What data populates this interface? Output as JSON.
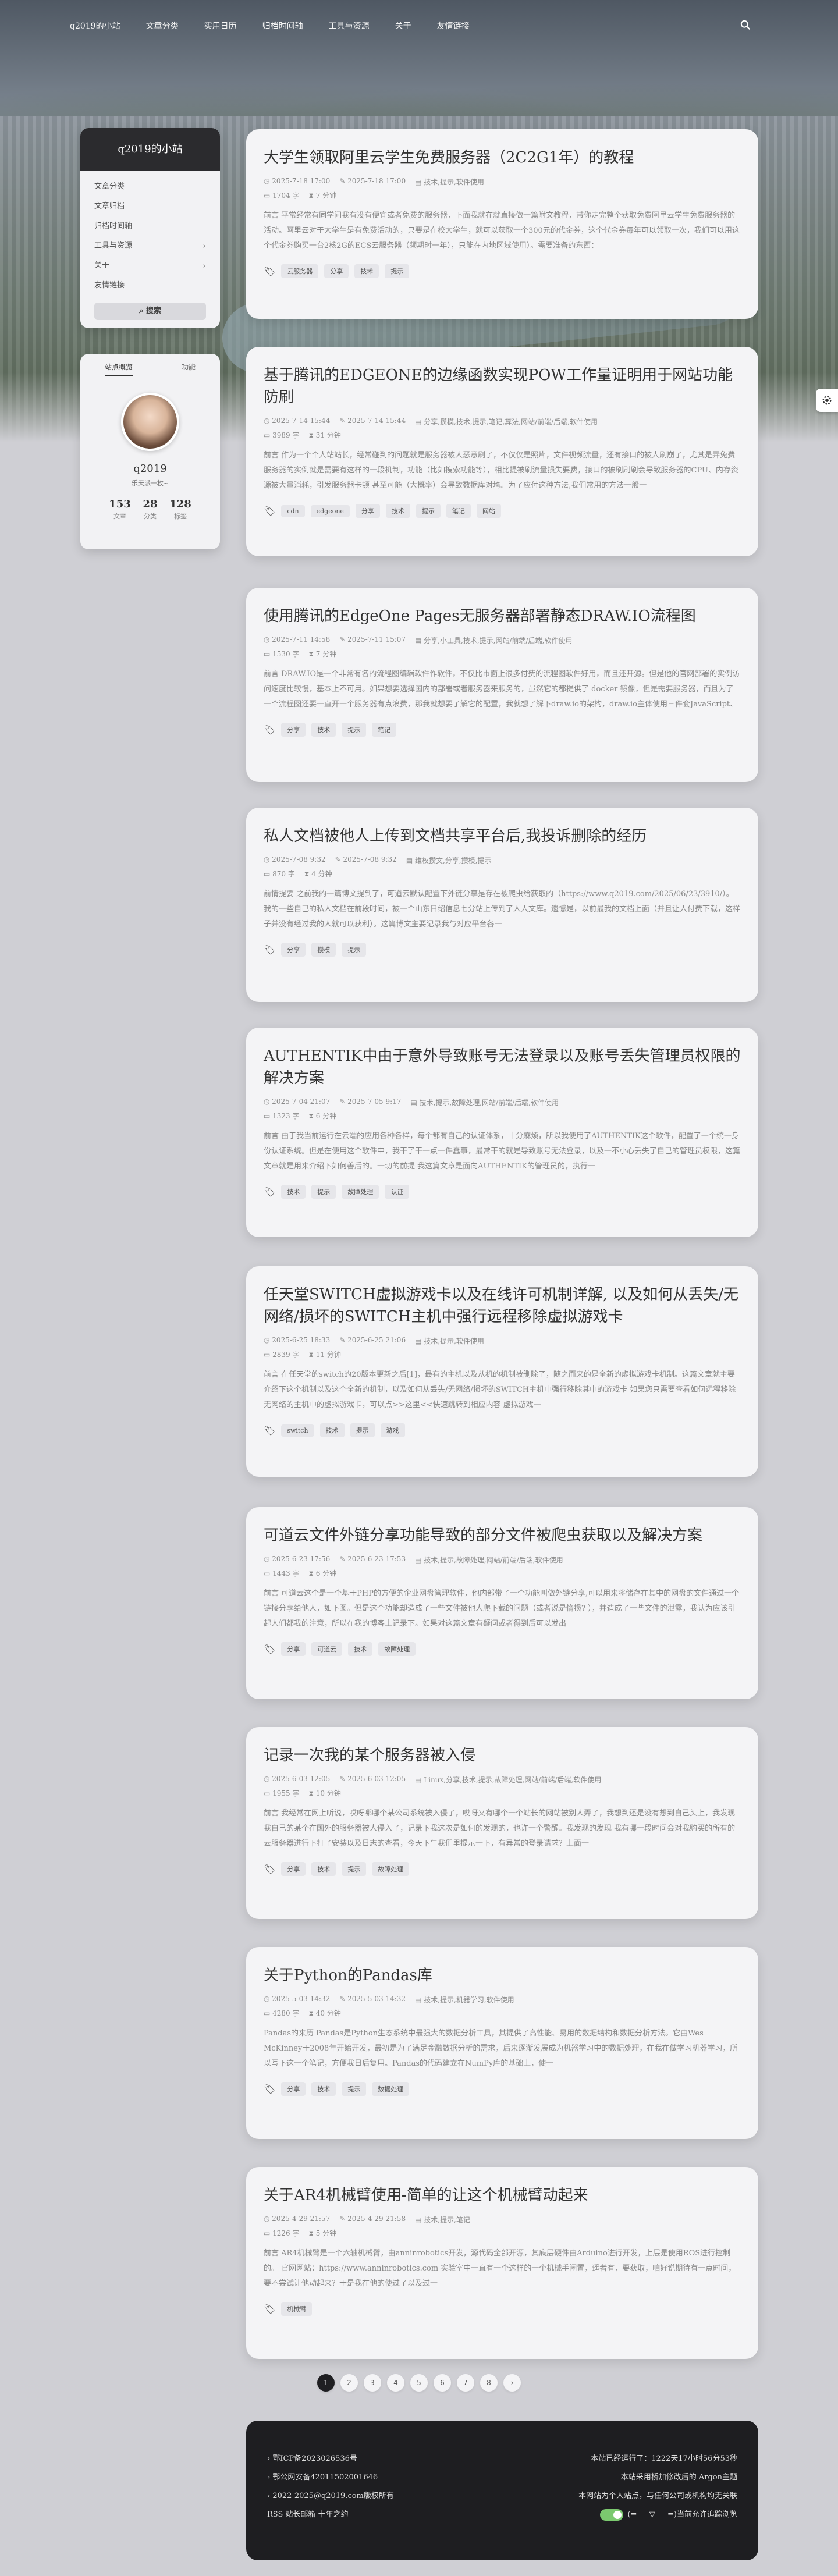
{
  "nav": {
    "site": "q2019的小站",
    "items": [
      "文章分类",
      "实用日历",
      "归档时间轴",
      "工具与资源",
      "关于",
      "友情链接"
    ]
  },
  "sidebar": {
    "title": "q2019的小站",
    "menu": [
      {
        "label": "文章分类",
        "chev": ""
      },
      {
        "label": "文章归档",
        "chev": ""
      },
      {
        "label": "归档时间轴",
        "chev": ""
      },
      {
        "label": "工具与资源",
        "chev": "›"
      },
      {
        "label": "关于",
        "chev": "›"
      },
      {
        "label": "友情链接",
        "chev": ""
      }
    ],
    "search_label": "搜索"
  },
  "profile": {
    "tab_overview": "站点概览",
    "tab_features": "功能",
    "name": "q2019",
    "motto": "乐天派一枚~",
    "stats": [
      {
        "n": "153",
        "l": "文章"
      },
      {
        "n": "28",
        "l": "分类"
      },
      {
        "n": "128",
        "l": "标签"
      }
    ]
  },
  "posts": [
    {
      "title": "大学生领取阿里云学生免费服务器（2C2G1年）的教程",
      "created": "2025-7-18 17:00",
      "updated": "2025-7-18 17:00",
      "cats": "技术,提示,软件使用",
      "words": "1704 字",
      "read": "7 分钟",
      "excerpt": "前言 平常经常有同学问我有没有便宜或者免费的服务器，下面我就在就直接做一篇附文教程，带你走完整个获取免费阿里云学生免费服务器的活动。阿里云对于大学生是有免费活动的，只要是在校大学生，就可以获取一个300元的代金券，这个代金券每年可以领取一次，我们可以用这个代金券购买一台2核2G的ECS云服务器（频期时一年），只能在内地区域使用）。需要准备的东西：",
      "tags": [
        "云服务器",
        "分享",
        "技术",
        "提示"
      ]
    },
    {
      "title": "基于腾讯的EDGEONE的边缘函数实现POW工作量证明用于网站功能防刷",
      "created": "2025-7-14 15:44",
      "updated": "2025-7-14 15:44",
      "cats": "分享,攒模,技术,提示,笔记,算法,网站/前端/后端,软件使用",
      "words": "3989 字",
      "read": "31 分钟",
      "excerpt": "前言 作为一个个人站站长，经常碰到的问题就是服务器被人恶意刷了，不仅仅是照片，文件视频流量，还有接口的被人刷崩了，尤其是弄免费服务器的实例就是需要有这样的一段机制，功能（比如搜索功能等），相比提被刷流量损失要费，接口的被刷刷刷会导致服务器的CPU、内存资源被大量消耗，引发服务器卡顿 甚至可能（大概率）会导致数据库对垮。为了应付这种方法,我们常用的方法一般一",
      "tags": [
        "cdn",
        "edgeone",
        "分享",
        "技术",
        "提示",
        "笔记",
        "网站"
      ]
    },
    {
      "title": "使用腾讯的EdgeOne Pages无服务器部署静态DRAW.IO流程图",
      "created": "2025-7-11 14:58",
      "updated": "2025-7-11 15:07",
      "cats": "分享,小工具,技术,提示,网站/前端/后端,软件使用",
      "words": "1530 字",
      "read": "7 分钟",
      "excerpt": "前言 DRAW.IO是一个非常有名的流程图编辑软件作软件，不仅比市面上很多付费的流程图软件好用，而且还开源。但是他的官网部署的实例访问速度比较慢，基本上不可用。如果想要选择国内的部署或者服务器来服务的，虽然它的都提供了 docker 镜像，但是需要服务器，而且为了一个流程图还要一直开一个服务器有点浪费，那我就想要了解它的配置，我就想了解下draw.io的架构，draw.io主体使用三件套JavaScript、Html一",
      "tags": [
        "分享",
        "技术",
        "提示",
        "笔记"
      ]
    },
    {
      "title": "私人文档被他人上传到文档共享平台后,我投诉删除的经历",
      "created": "2025-7-08 9:32",
      "updated": "2025-7-08 9:32",
      "cats": "维权攒文,分享,攒模,提示",
      "words": "870 字",
      "read": "4 分钟",
      "excerpt": "前情提要 之前我的一篇博文提到了，可道云默认配置下外链分享是存在被爬虫给获取的（https://www.q2019.com/2025/06/23/3910/）。我的一些自己的私人文档在前段时间，被一个山东日绍信息七分站上传到了人人文库。遗憾是，以前最我的文档上面（并且让人付费下载，这样子并没有经过我的人就可以获利）。这篇博文主要记录我与对应平台各一",
      "tags": [
        "分享",
        "攒模",
        "提示"
      ]
    },
    {
      "title": "AUTHENTIK中由于意外导致账号无法登录以及账号丢失管理员权限的解决方案",
      "created": "2025-7-04 21:07",
      "updated": "2025-7-05 9:17",
      "cats": "技术,提示,故障处理,网站/前端/后端,软件使用",
      "words": "1323 字",
      "read": "6 分钟",
      "excerpt": "前言 由于我当前运行在云端的应用各种各样，每个都有自己的认证体系，十分麻烦，所以我使用了AUTHENTIK这个软件，配置了一个统一身份认证系统。但是在使用这个软件中，我干了干一点一件蠢事，最常干的就是导致账号无法登录，以及一不小心丢失了自己的管理员权限，这篇文章就是用来介绍下如何善后的。一切的前提 我这篇文章是面向AUTHENTIK的管理员的，执行一",
      "tags": [
        "技术",
        "提示",
        "故障处理",
        "认证"
      ]
    },
    {
      "title": "任天堂SWITCH虚拟游戏卡以及在线许可机制详解, 以及如何从丢失/无网络/损坏的SWITCH主机中强行远程移除虚拟游戏卡",
      "created": "2025-6-25 18:33",
      "updated": "2025-6-25 21:06",
      "cats": "技术,提示,软件使用",
      "words": "2839 字",
      "read": "11 分钟",
      "excerpt": "前言 在任天堂的switch的20版本更新之后[1]，最有的主机以及从机的机制被删除了，随之而来的是全新的虚拟游戏卡机制。这篇文章就主要介绍下这个机制以及这个全新的机制，以及如何从丢失/无网络/损坏的SWITCH主机中强行移除其中的游戏卡 如果您只需要查看如何远程移除无网络的主机中的虚拟游戏卡，可以点>>这里<<快速跳转到相应内容 虚拟游戏一",
      "tags": [
        "switch",
        "技术",
        "提示",
        "游戏"
      ]
    },
    {
      "title": "可道云文件外链分享功能导致的部分文件被爬虫获取以及解决方案",
      "created": "2025-6-23 17:56",
      "updated": "2025-6-23 17:53",
      "cats": "技术,提示,故障处理,网站/前端/后端,软件使用",
      "words": "1443 字",
      "read": "6 分钟",
      "excerpt": "前言 可道云这个是一个基于PHP的方便的企业网盘管理软件，他内部带了一个功能叫做外链分享,可以用来将储存在其中的网盘的文件通过一个链接分享给他人，如下图。但是这个功能却造成了一些文件被他人爬下载的问题（或者说是惰损? ），并造成了一些文件的泄露，我认为应该引起人们都我的注意，所以在我的博客上记录下。如果对这篇文章有疑问或者得到后可以发出",
      "tags": [
        "分享",
        "可道云",
        "技术",
        "故障处理"
      ]
    },
    {
      "title": "记录一次我的某个服务器被入侵",
      "created": "2025-6-03 12:05",
      "updated": "2025-6-03 12:05",
      "cats": "Linux,分享,技术,提示,故障处理,网站/前端/后端,软件使用",
      "words": "1955 字",
      "read": "10 分钟",
      "excerpt": "前言 我经常在网上听说，哎呀哪哪个某公司系统被入侵了，哎呀又有哪个一个站长的网站被别人弄了，我想到还是没有想到自己头上，我发现我自己的某个在国外的服务器被人侵入了，记录下我这次是如何的发现的，也许一个警醒。我发现的发现 我有哪一段时间会对我购买的所有的云服务器进行下打了安装以及日志的查看，今天下午我们里提示一下，有异常的登录请求？上面一",
      "tags": [
        "分享",
        "技术",
        "提示",
        "故障处理"
      ]
    },
    {
      "title": "关于Python的Pandas库",
      "created": "2025-5-03 14:32",
      "updated": "2025-5-03 14:32",
      "cats": "技术,提示,机器学习,软件使用",
      "words": "4280 字",
      "read": "40 分钟",
      "excerpt": "Pandas的来历 Pandas是Python生态系统中最强大的数据分析工具，其提供了高性能、易用的数据结构和数据分析方法。它由Wes McKinney于2008年开始开发，最初是为了满足金融数据分析的需求，后来逐渐发展成为机器学习中的数据处理，在我在做学习机器学习，所以写下这一个笔记，方便我日后复用。Pandas的代码建立在NumPy库的基础上，使一",
      "tags": [
        "分享",
        "技术",
        "提示",
        "数据处理"
      ]
    },
    {
      "title": "关于AR4机械臂使用-简单的让这个机械臂动起来",
      "created": "2025-4-29 21:57",
      "updated": "2025-4-29 21:58",
      "cats": "技术,提示,笔记",
      "words": "1226 字",
      "read": "5 分钟",
      "excerpt": "前言 AR4机械臂是一个六轴机械臂，由anninrobotics开发，源代码全部开源，其底层硬件由Arduino进行开发，上层是使用ROS进行控制的。 官网网站：https://www.anninrobotics.com 实验室中一直有一个这样的一个机械手闲置，遥者有，要获取，咱好说期待有一点时间，要不尝试让他动起来？于是我在他的使过了以及过一",
      "tags": [
        "机械臂"
      ]
    }
  ],
  "pager": [
    "1",
    "2",
    "3",
    "4",
    "5",
    "6",
    "7",
    "8",
    "›"
  ],
  "footer": {
    "l1": "鄂ICP备2023026536号",
    "l2": "鄂公网安备42011502001646",
    "l3": "2022-2025@q2019.com版权所有",
    "l4": "RSS  站长邮箱  十年之约",
    "r1": "本站已经运行了：1222天17小时56分53秒",
    "r2": "本站采用桥加修改后的 Argon主题",
    "r3": "本网站为个人站点，与任何公司或机构均无关联",
    "r4": "(= ￣ ▽ ￣ =)当前允许追踪浏览"
  }
}
